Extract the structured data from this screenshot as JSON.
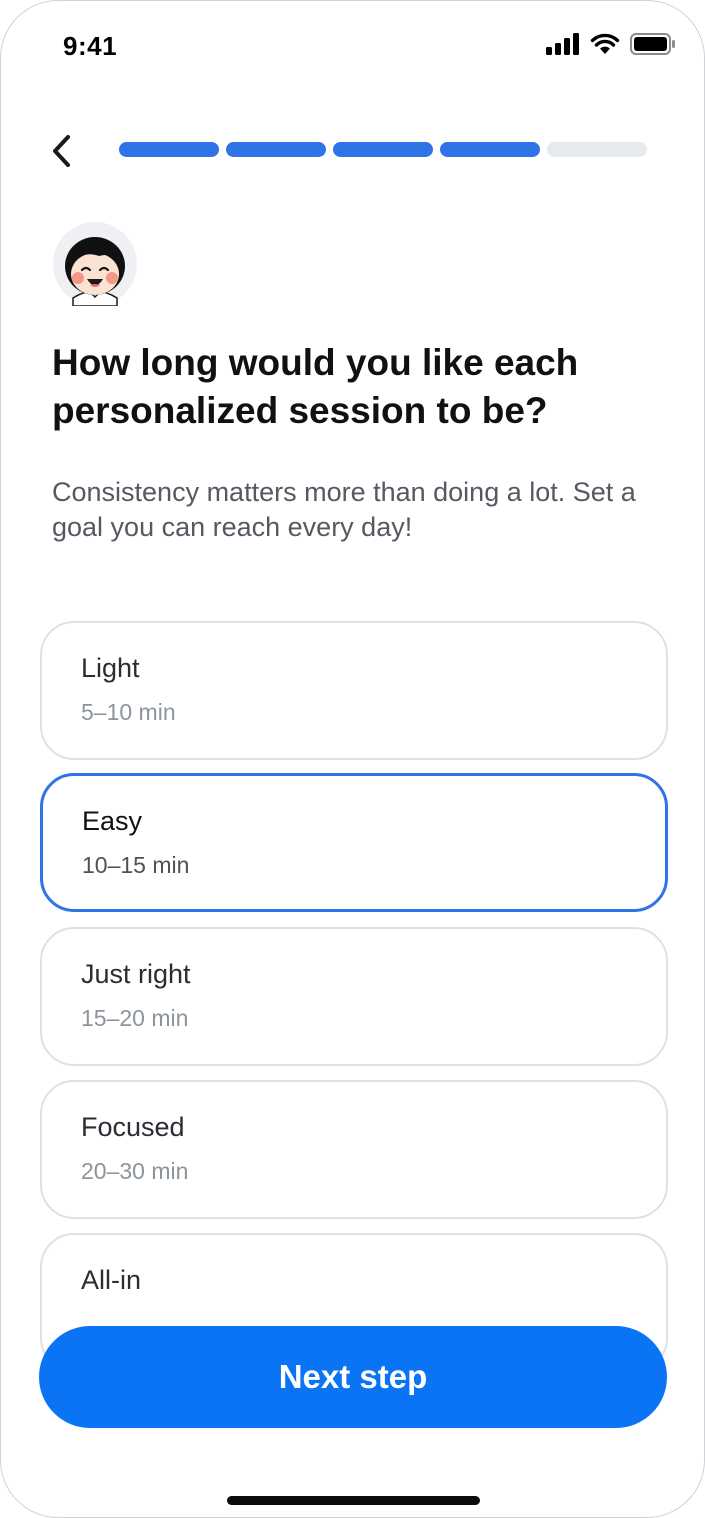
{
  "status_bar": {
    "time": "9:41"
  },
  "progress": {
    "total_steps": 5,
    "completed_steps": 4,
    "accent_color": "#2f74e6"
  },
  "question": {
    "title": "How long would you like each personalized session to be?",
    "subtitle": "Consistency matters more than doing a lot. Set a goal you can reach every day!"
  },
  "options": [
    {
      "label": "Light",
      "duration": "5–10 min",
      "selected": false
    },
    {
      "label": "Easy",
      "duration": "10–15 min",
      "selected": true
    },
    {
      "label": "Just right",
      "duration": "15–20 min",
      "selected": false
    },
    {
      "label": "Focused",
      "duration": "20–30 min",
      "selected": false
    },
    {
      "label": "All-in",
      "duration": "",
      "selected": false
    }
  ],
  "cta": {
    "label": "Next step",
    "color": "#0a74f5"
  },
  "icons": {
    "back": "chevron-left-icon",
    "signal": "signal-icon",
    "wifi": "wifi-icon",
    "battery": "battery-icon",
    "avatar": "mascot-avatar"
  }
}
